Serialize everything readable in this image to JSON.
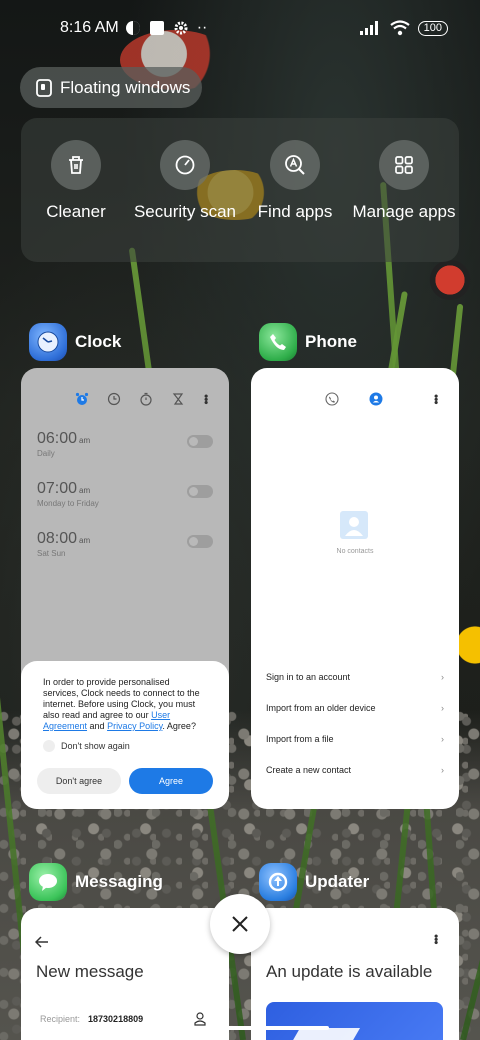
{
  "status_bar": {
    "time": "8:16 AM",
    "battery": "100",
    "more": "··"
  },
  "floating_windows": {
    "label": "Floating windows"
  },
  "quick_actions": [
    {
      "label": "Cleaner",
      "icon": "trash-icon"
    },
    {
      "label": "Security scan",
      "icon": "security-scan-icon"
    },
    {
      "label": "Find apps",
      "icon": "find-apps-icon"
    },
    {
      "label": "Manage apps",
      "icon": "manage-apps-icon"
    }
  ],
  "apps": {
    "clock": {
      "name": "Clock",
      "alarms": [
        {
          "time": "06:00",
          "ampm": "am",
          "repeat": "Daily"
        },
        {
          "time": "07:00",
          "ampm": "am",
          "repeat": "Monday to Friday"
        },
        {
          "time": "08:00",
          "ampm": "am",
          "repeat": "Sat Sun"
        }
      ],
      "dialog": {
        "text_before": "In order to provide personalised services, Clock needs to connect to the internet. Before using Clock, you must also read and agree to our ",
        "link1": "User Agreement",
        "middle": " and ",
        "link2": "Privacy Policy",
        "text_after": ". Agree?",
        "checkbox": "Don't show again",
        "disagree": "Don't agree",
        "agree": "Agree"
      }
    },
    "phone": {
      "name": "Phone",
      "empty": "No contacts",
      "options": [
        "Sign in to an account",
        "Import from an older device",
        "Import from a file",
        "Create a new contact"
      ],
      "chevron": "›"
    },
    "messaging": {
      "name": "Messaging",
      "title": "New message",
      "recipient_label": "Recipient:",
      "recipient_value": "18730218809"
    },
    "updater": {
      "name": "Updater",
      "title": "An update is available"
    }
  },
  "colors": {
    "accent": "#1e7ae6",
    "clock_icon": "#2f6fd8",
    "phone_icon": "#2fae4a",
    "messaging_icon": "#3cc45a",
    "updater_icon": "#2a7ee0"
  },
  "close": {
    "icon": "close-icon"
  }
}
